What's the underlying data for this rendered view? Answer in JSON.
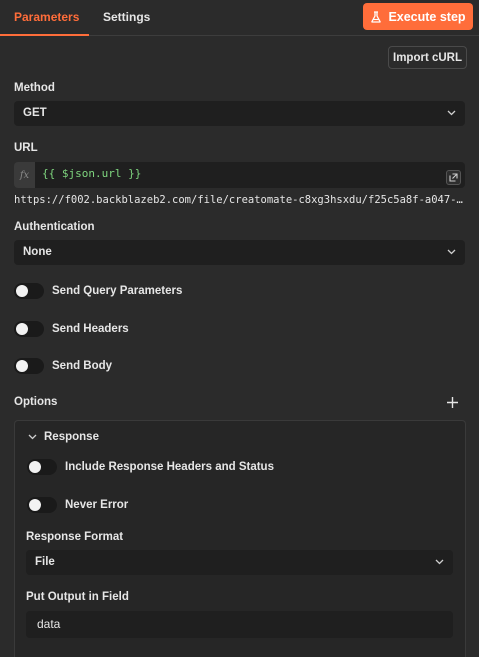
{
  "tabs": [
    {
      "label": "Parameters",
      "active": true
    },
    {
      "label": "Settings",
      "active": false
    }
  ],
  "execute_button": "Execute step",
  "import_curl_button": "Import cURL",
  "method": {
    "label": "Method",
    "value": "GET"
  },
  "url": {
    "label": "URL",
    "fx": "fx",
    "expression": "{{ $json.url }}",
    "preview": "https://f002.backblazeb2.com/file/creatomate-c8xg3hsxdu/f25c5a8f-a047-4bca-…"
  },
  "authentication": {
    "label": "Authentication",
    "value": "None"
  },
  "toggles": {
    "send_query": "Send Query Parameters",
    "send_headers": "Send Headers",
    "send_body": "Send Body"
  },
  "options": {
    "label": "Options",
    "response": {
      "title": "Response",
      "include_headers": "Include Response Headers and Status",
      "never_error": "Never Error",
      "format_label": "Response Format",
      "format_value": "File",
      "output_label": "Put Output in Field",
      "output_value": "data"
    }
  },
  "colors": {
    "accent": "#ff6d3a",
    "background": "#2b2b2b",
    "input_bg": "#1f1f1f",
    "expression_text": "#7fd67f"
  }
}
